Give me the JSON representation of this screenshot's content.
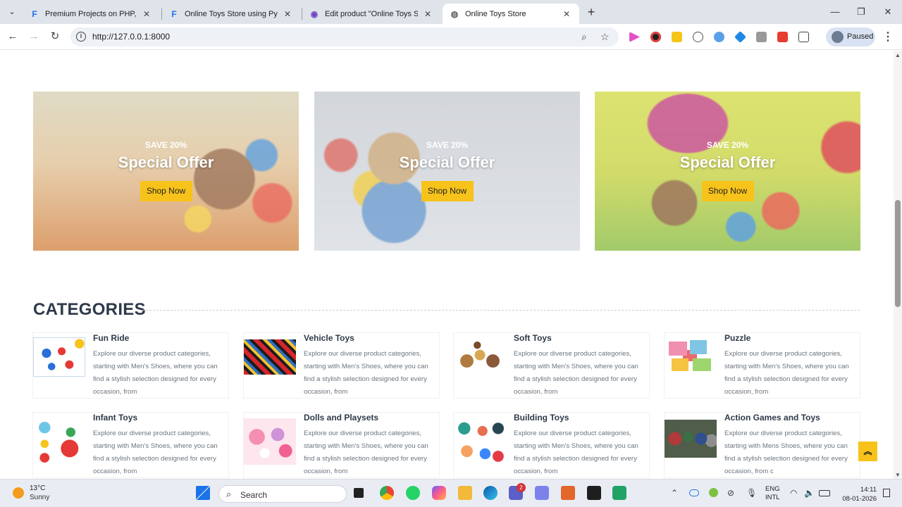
{
  "browser": {
    "tabs": [
      {
        "title": "Premium Projects on PHP, Java",
        "favicon": "F",
        "favicon_color": "#1a73e8"
      },
      {
        "title": "Online Toys Store using Python",
        "favicon": "F",
        "favicon_color": "#1a73e8"
      },
      {
        "title": "Edit product \"Online Toys Store\"",
        "favicon": "eye",
        "favicon_color": "#6f42c1"
      },
      {
        "title": "Online Toys Store",
        "favicon": "globe",
        "favicon_color": "#5f6368",
        "active": true
      }
    ],
    "url": "http://127.0.0.1:8000",
    "profile_label": "Paused"
  },
  "offers": [
    {
      "tag": "SAVE 20%",
      "title": "Special Offer",
      "button": "Shop Now",
      "background": "orange-toys"
    },
    {
      "tag": "SAVE 20%",
      "title": "Special Offer",
      "button": "Shop Now",
      "background": "grey-toys"
    },
    {
      "tag": "SAVE 20%",
      "title": "Special Offer",
      "button": "Shop Now",
      "background": "green-toys"
    }
  ],
  "categories_heading": "CATEGORIES",
  "categories": [
    {
      "name": "Fun Ride",
      "desc": "Explore our diverse product categories, starting with Men's Shoes, where you can find a stylish selection designed for every occasion, from"
    },
    {
      "name": "Vehicle Toys",
      "desc": "Explore our diverse product categories, starting with Men's Shoes, where you can find a stylish selection designed for every occasion, from"
    },
    {
      "name": "Soft Toys",
      "desc": "Explore our diverse product categories, starting with Men's Shoes, where you can find a stylish selection designed for every occasion, from"
    },
    {
      "name": "Puzzle",
      "desc": "Explore our diverse product categories, starting with Men's Shoes, where you can find a stylish selection designed for every occasion, from"
    },
    {
      "name": "Infant Toys",
      "desc": "Explore our diverse product categories, starting with Men's Shoes, where you can find a stylish selection designed for every occasion, from"
    },
    {
      "name": "Dolls and Playsets",
      "desc": "Explore our diverse product categories, starting with Men's Shoes, where you can find a stylish selection designed for every occasion, from"
    },
    {
      "name": "Building Toys",
      "desc": "Explore our diverse product categories, starting with Men's Shoes, where you can find a stylish selection designed for every occasion, from"
    },
    {
      "name": "Action Games and Toys",
      "desc": "Explore our diverse product categories, starting with Mens Shoes, where you can find a stylish selection designed for every occasion, from c"
    }
  ],
  "taskbar": {
    "temperature": "13°C",
    "condition": "Sunny",
    "search_label": "Search",
    "teams_badge": "2",
    "lang_top": "ENG",
    "lang_bottom": "INTL",
    "time": "14:11",
    "date": "08-01-2026"
  },
  "colors": {
    "accent": "#f7c31b",
    "heading": "#2e3a4a",
    "desc_text": "#6c757d"
  }
}
